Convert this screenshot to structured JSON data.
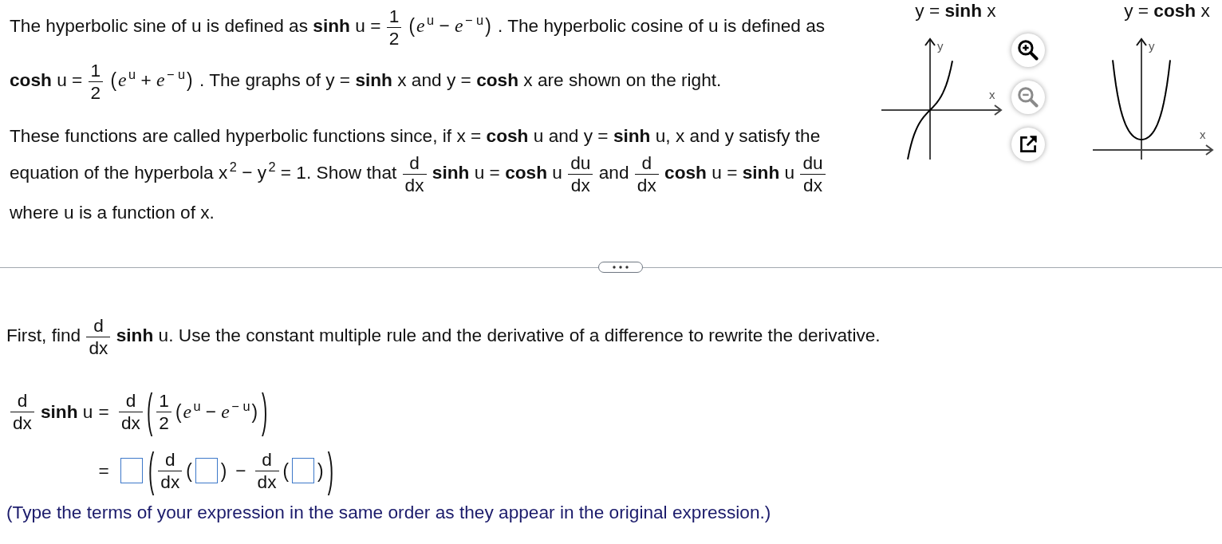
{
  "intro": {
    "paragraphs": [
      [
        {
          "kind": "text",
          "text": "The hyperbolic sine of u is defined as **sinh** u ="
        },
        {
          "kind": "frac",
          "num": "1",
          "den": "2"
        },
        {
          "kind": "group",
          "open": "(",
          "close": ")",
          "items": [
            {
              "kind": "text",
              "text": "*e*$^{u}$ − *e*$^{− u}$"
            }
          ]
        },
        {
          "kind": "text",
          "text": ". The hyperbolic cosine of u is defined as **cosh** u ="
        },
        {
          "kind": "frac",
          "num": "1",
          "den": "2"
        },
        {
          "kind": "group",
          "open": "(",
          "close": ")",
          "items": [
            {
              "kind": "text",
              "text": "*e*$^{u}$ + *e*$^{− u}$"
            }
          ]
        },
        {
          "kind": "text",
          "text": ". The graphs of y = **sinh** x and y = **cosh** x are shown on the right."
        }
      ],
      [
        {
          "kind": "text",
          "text": "These functions are called hyperbolic functions since, if x = **cosh** u and y = **sinh** u, x and y satisfy the equation of the hyperbola x$^{2}$ − y$^{2}$ = 1. Show that"
        },
        {
          "kind": "frac",
          "num": "d",
          "den": "dx"
        },
        {
          "kind": "text",
          "text": "**sinh** u = **cosh** u"
        },
        {
          "kind": "frac",
          "num": "du",
          "den": "dx"
        },
        {
          "kind": "text",
          "text": "and"
        },
        {
          "kind": "frac",
          "num": "d",
          "den": "dx"
        },
        {
          "kind": "text",
          "text": "**cosh** u = **sinh** u"
        },
        {
          "kind": "frac",
          "num": "du",
          "den": "dx"
        },
        {
          "kind": "text",
          "text": "where u is a function of x."
        }
      ]
    ]
  },
  "graphs": [
    {
      "title": "y = **sinh** x",
      "kind": "sinh",
      "x_label": "x",
      "y_label": "y",
      "tools": [
        {
          "kind": "zoom_in",
          "disabled": false
        },
        {
          "kind": "zoom_out",
          "disabled": true
        },
        {
          "kind": "pop_out",
          "disabled": false
        }
      ]
    },
    {
      "title": "y = **cosh** x",
      "kind": "cosh",
      "x_label": "x",
      "y_label": "y"
    }
  ],
  "question": {
    "prompt": [
      {
        "kind": "text",
        "text": "First, find"
      },
      {
        "kind": "frac",
        "num": "d",
        "den": "dx"
      },
      {
        "kind": "text",
        "text": "**sinh** u. Use the constant multiple rule and the derivative of a difference to rewrite the derivative."
      }
    ],
    "equation": [
      {
        "lhs": [
          {
            "kind": "frac",
            "num": "d",
            "den": "dx"
          },
          {
            "kind": "text",
            "text": "**sinh** u"
          }
        ],
        "sign": "=",
        "rhs": [
          {
            "kind": "frac",
            "num": "d",
            "den": "dx"
          },
          {
            "kind": "group",
            "open": "(",
            "close": ")",
            "items": [
              {
                "kind": "frac",
                "num": "1",
                "den": "2"
              },
              {
                "kind": "group",
                "open": "(",
                "close": ")",
                "items": [
                  {
                    "kind": "text",
                    "text": "*e*$^{u}$ − *e*$^{− u}$"
                  }
                ]
              }
            ]
          }
        ]
      },
      {
        "sign": "=",
        "rhs": [
          {
            "kind": "input"
          },
          {
            "kind": "group",
            "open": "(",
            "close": ")",
            "items": [
              {
                "kind": "frac",
                "num": "d",
                "den": "dx"
              },
              {
                "kind": "group",
                "open": "(",
                "close": ")",
                "items": [
                  {
                    "kind": "input"
                  }
                ]
              },
              {
                "kind": "operator",
                "text": "−"
              },
              {
                "kind": "frac",
                "num": "d",
                "den": "dx"
              },
              {
                "kind": "group",
                "open": "(",
                "close": ")",
                "items": [
                  {
                    "kind": "input"
                  }
                ]
              }
            ]
          }
        ]
      }
    ],
    "hint": "(Type the terms of your expression in the same order as they appear in the original expression.)"
  }
}
